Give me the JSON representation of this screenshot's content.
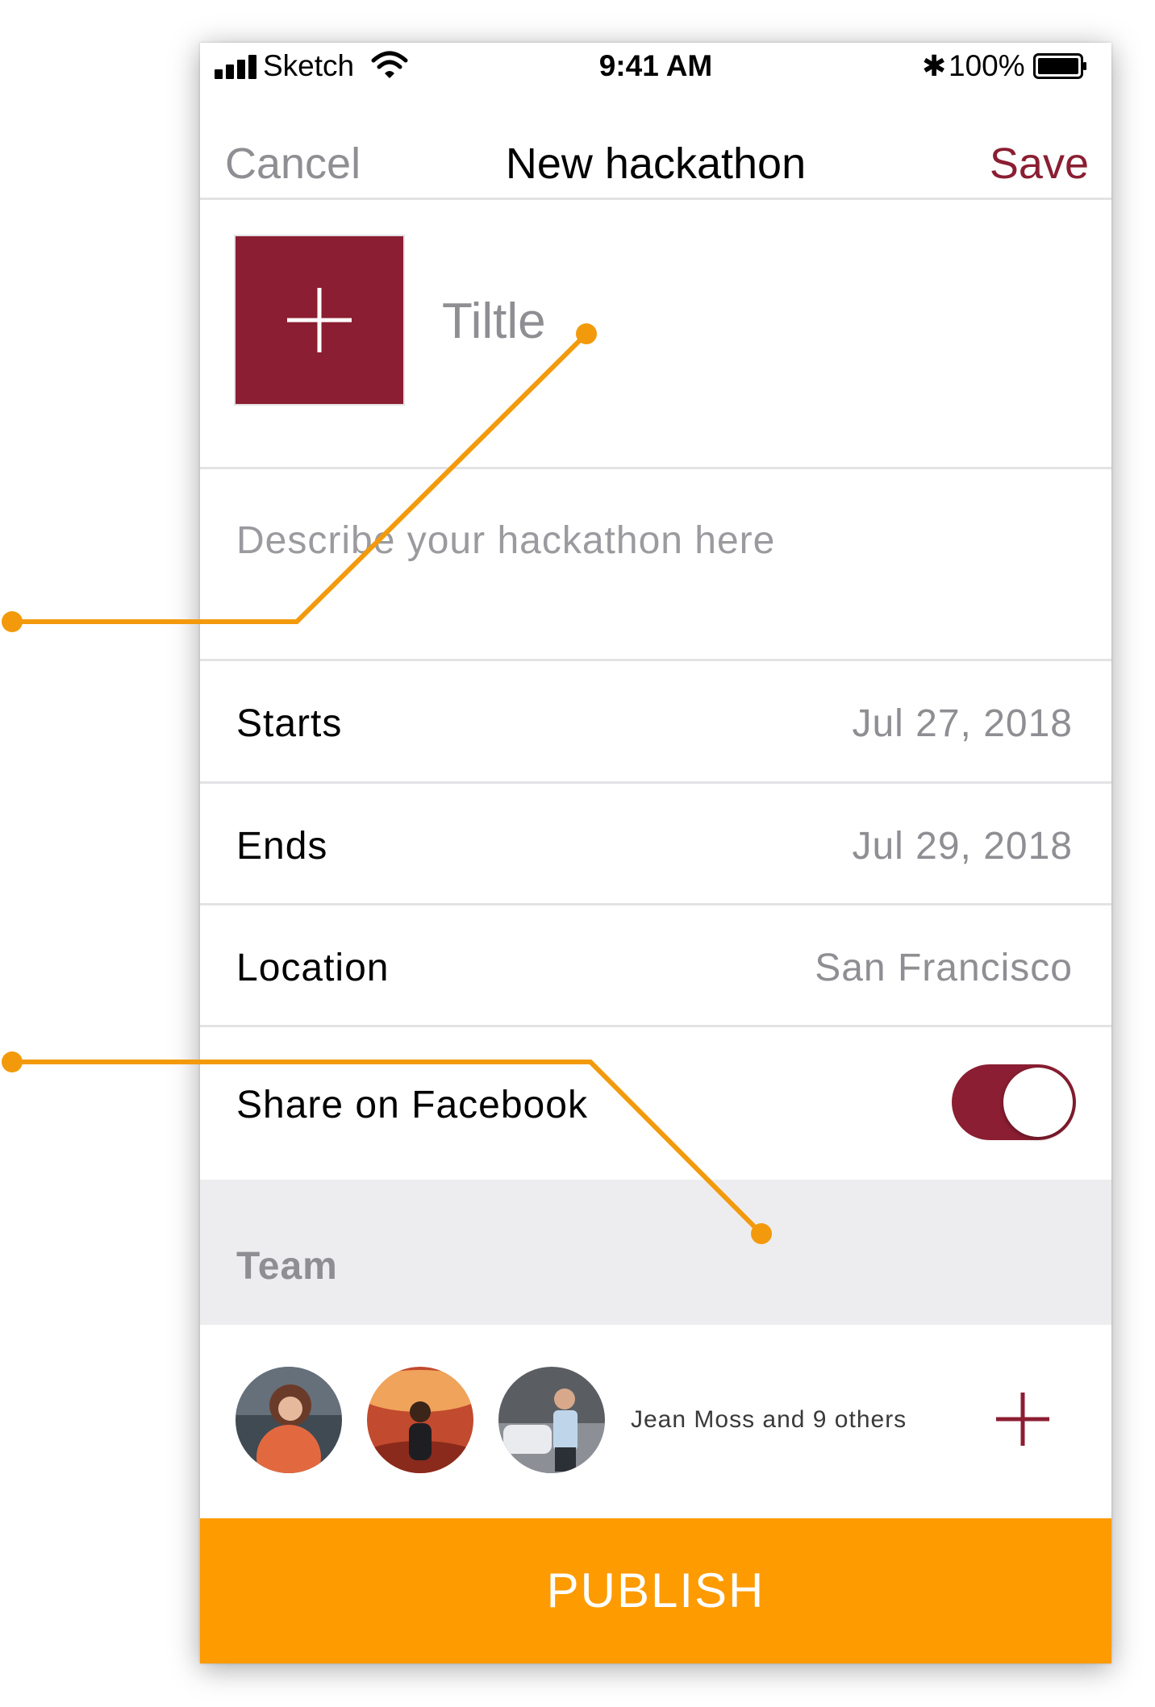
{
  "status_bar": {
    "carrier": "Sketch",
    "time": "9:41 AM",
    "bluetooth": "✱",
    "battery_percent": "100%",
    "signal_icon": "signal-bars-icon",
    "wifi_icon": "wifi-icon",
    "battery_icon": "battery-icon"
  },
  "nav": {
    "cancel_label": "Cancel",
    "title": "New hackathon",
    "save_label": "Save"
  },
  "form": {
    "add_image_icon": "plus-icon",
    "title_placeholder": "Tiltle",
    "description_placeholder": "Describe your hackathon here",
    "rows": [
      {
        "label": "Starts",
        "value": "Jul 27, 2018"
      },
      {
        "label": "Ends",
        "value": "Jul 29, 2018"
      },
      {
        "label": "Location",
        "value": "San Francisco"
      }
    ],
    "share_label": "Share on Facebook",
    "share_enabled": true
  },
  "team": {
    "section_title": "Team",
    "members_text": "Jean Moss and 9 others",
    "avatars": [
      "avatar-1",
      "avatar-2",
      "avatar-3"
    ],
    "add_icon": "plus-icon"
  },
  "publish_label": "PUBLISH",
  "colors": {
    "brand": "#8b1e32",
    "accent": "#fd9b00",
    "annotation": "#f39a0c",
    "placeholder": "#8e8e93",
    "section_bg": "#ededef"
  }
}
